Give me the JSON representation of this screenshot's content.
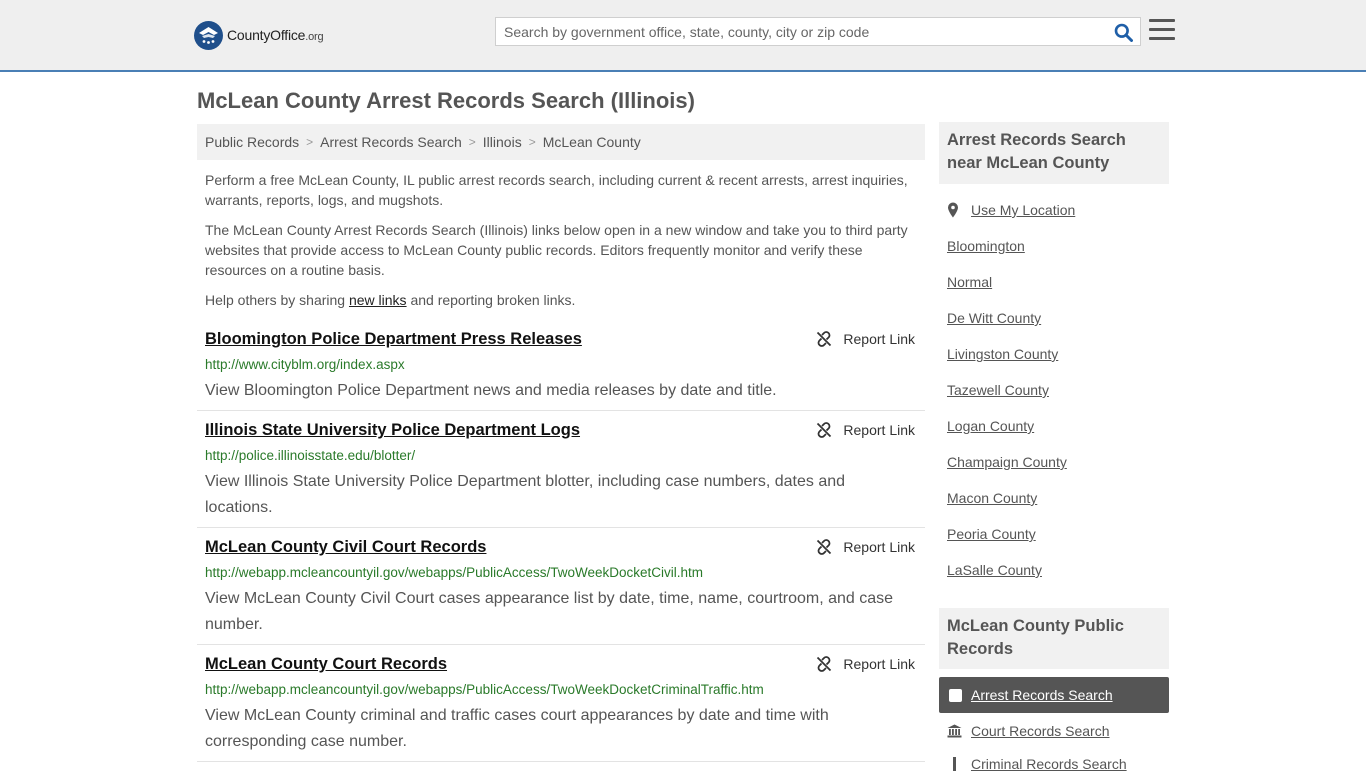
{
  "header": {
    "logo_main": "CountyOffice",
    "logo_suffix": ".org",
    "search_placeholder": "Search by government office, state, county, city or zip code"
  },
  "page_title": "McLean County Arrest Records Search (Illinois)",
  "breadcrumb": [
    "Public Records",
    "Arrest Records Search",
    "Illinois",
    "McLean County"
  ],
  "intro": {
    "p1": "Perform a free McLean County, IL public arrest records search, including current & recent arrests, arrest inquiries, warrants, reports, logs, and mugshots.",
    "p2": "The McLean County Arrest Records Search (Illinois) links below open in a new window and take you to third party websites that provide access to McLean County public records. Editors frequently monitor and verify these resources on a routine basis.",
    "p3_before": "Help others by sharing ",
    "p3_link": "new links",
    "p3_after": " and reporting broken links."
  },
  "report_label": "Report Link",
  "results": [
    {
      "title": "Bloomington Police Department Press Releases",
      "url": "http://www.cityblm.org/index.aspx",
      "desc": "View Bloomington Police Department news and media releases by date and title."
    },
    {
      "title": "Illinois State University Police Department Logs",
      "url": "http://police.illinoisstate.edu/blotter/",
      "desc": "View Illinois State University Police Department blotter, including case numbers, dates and locations."
    },
    {
      "title": "McLean County Civil Court Records",
      "url": "http://webapp.mcleancountyil.gov/webapps/PublicAccess/TwoWeekDocketCivil.htm",
      "desc": "View McLean County Civil Court cases appearance list by date, time, name, courtroom, and case number."
    },
    {
      "title": "McLean County Court Records",
      "url": "http://webapp.mcleancountyil.gov/webapps/PublicAccess/TwoWeekDocketCriminalTraffic.htm",
      "desc": "View McLean County criminal and traffic cases court appearances by date and time with corresponding case number."
    }
  ],
  "sidebar": {
    "near_heading": "Arrest Records Search near McLean County",
    "use_location": "Use My Location",
    "near_links": [
      "Bloomington",
      "Normal",
      "De Witt County",
      "Livingston County",
      "Tazewell County",
      "Logan County",
      "Champaign County",
      "Macon County",
      "Peoria County",
      "LaSalle County"
    ],
    "public_heading": "McLean County Public Records",
    "public_active": "Arrest Records Search",
    "public_links": [
      "Court Records Search",
      "Criminal Records Search"
    ]
  }
}
